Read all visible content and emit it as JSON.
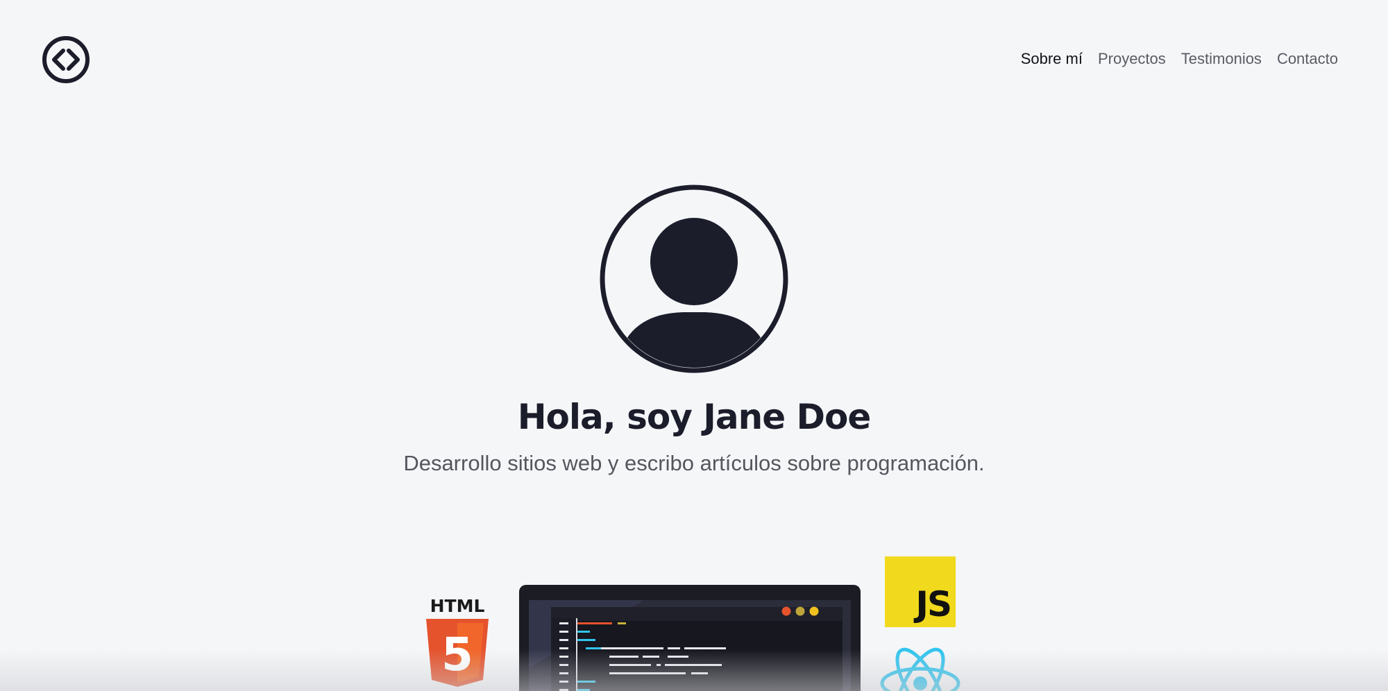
{
  "header": {
    "logo_icon": "code-brackets-icon",
    "nav": [
      {
        "label": "Sobre mí",
        "active": true
      },
      {
        "label": "Proyectos",
        "active": false
      },
      {
        "label": "Testimonios",
        "active": false
      },
      {
        "label": "Contacto",
        "active": false
      }
    ]
  },
  "hero": {
    "avatar_icon": "user-avatar-icon",
    "title": "Hola, soy Jane Doe",
    "subtitle": "Desarrollo sitios web y escribo artículos sobre programación."
  },
  "illustration": {
    "html_badge_text": "HTML",
    "html_badge_number": "5",
    "js_badge_text": "JS",
    "laptop_icon": "laptop-code-icon",
    "react_icon": "react-atom-icon"
  },
  "colors": {
    "background": "#f5f6f8",
    "ink": "#1c1d2b",
    "html_orange": "#e5532d",
    "js_yellow": "#f1d91e",
    "react_cyan": "#32c5ee"
  }
}
